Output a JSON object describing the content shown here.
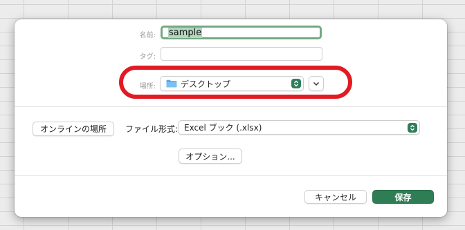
{
  "dialog": {
    "name_label": "名前:",
    "name_value": "sample",
    "tag_label": "タグ:",
    "tag_value": "",
    "location_label": "場所:",
    "location_value": "デスクトップ",
    "online_button": "オンラインの場所",
    "format_label": "ファイル形式:",
    "format_value": "Excel ブック (.xlsx)",
    "options_button": "オプション...",
    "cancel_button": "キャンセル",
    "save_button": "保存"
  },
  "colors": {
    "highlight": "#e21a23",
    "accent": "#2f7d55",
    "folder": "#5aa8e6"
  },
  "icons": [
    "folder-icon",
    "updown-stepper-icon",
    "chevron-down-icon"
  ]
}
